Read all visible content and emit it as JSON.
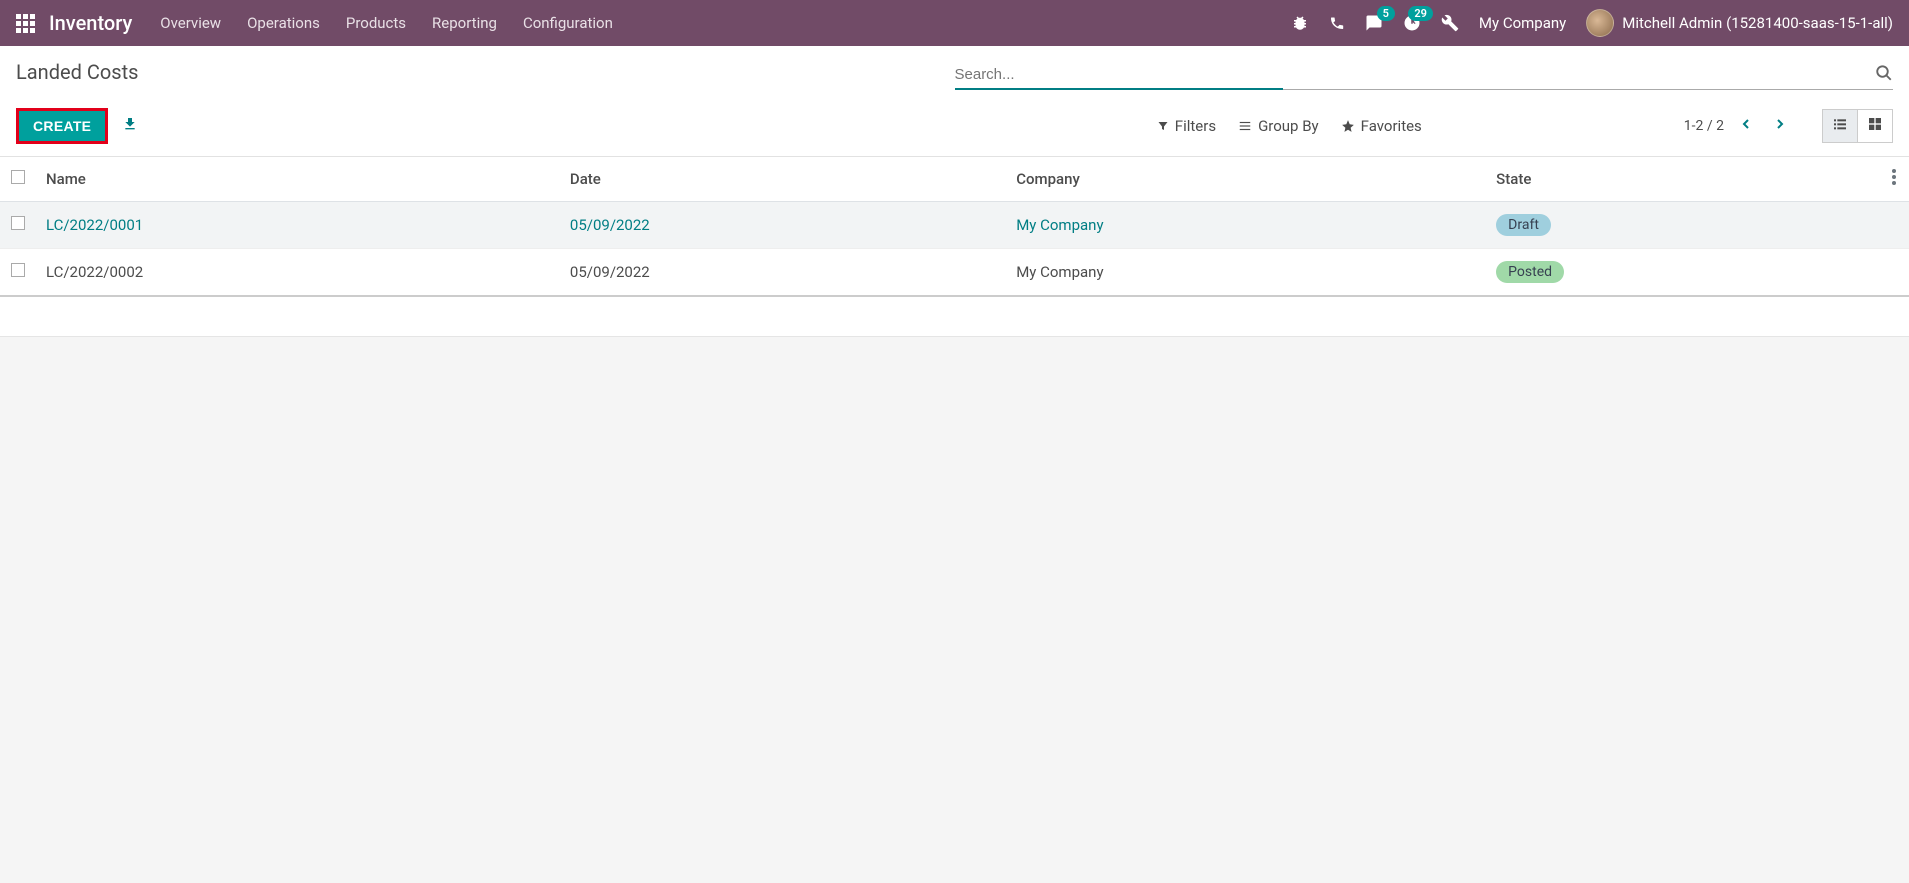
{
  "topnav": {
    "brand": "Inventory",
    "links": [
      "Overview",
      "Operations",
      "Products",
      "Reporting",
      "Configuration"
    ],
    "chat_badge": "5",
    "activity_badge": "29",
    "company": "My Company",
    "user": "Mitchell Admin (15281400-saas-15-1-all)"
  },
  "page": {
    "title": "Landed Costs",
    "search_placeholder": "Search...",
    "create_label": "CREATE",
    "filters_label": "Filters",
    "groupby_label": "Group By",
    "favorites_label": "Favorites",
    "pager": "1-2 / 2"
  },
  "table": {
    "headers": {
      "name": "Name",
      "date": "Date",
      "company": "Company",
      "state": "State"
    },
    "rows": [
      {
        "name": "LC/2022/0001",
        "date": "05/09/2022",
        "company": "My Company",
        "state": "Draft",
        "state_class": "badge-draft",
        "hover": true
      },
      {
        "name": "LC/2022/0002",
        "date": "05/09/2022",
        "company": "My Company",
        "state": "Posted",
        "state_class": "badge-posted",
        "hover": false
      }
    ]
  }
}
